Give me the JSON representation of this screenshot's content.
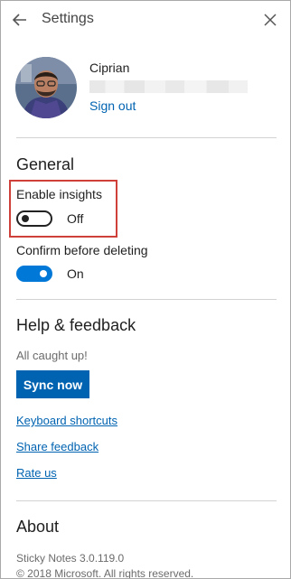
{
  "header": {
    "title": "Settings"
  },
  "account": {
    "name": "Ciprian",
    "sign_out": "Sign out"
  },
  "general": {
    "heading": "General",
    "enable_insights": {
      "label": "Enable insights",
      "state": "Off"
    },
    "confirm_delete": {
      "label": "Confirm before deleting",
      "state": "On"
    }
  },
  "help": {
    "heading": "Help & feedback",
    "status": "All caught up!",
    "sync_button": "Sync now",
    "links": {
      "keyboard_shortcuts": "Keyboard shortcuts",
      "share_feedback": "Share feedback",
      "rate_us": "Rate us"
    }
  },
  "about": {
    "heading": "About",
    "version": "Sticky Notes 3.0.119.0",
    "copyright": "© 2018 Microsoft. All rights reserved."
  },
  "colors": {
    "accent": "#0078d7",
    "link": "#0063b1",
    "highlight_border": "#d0403a"
  },
  "icons": {
    "back": "back-arrow-icon",
    "close": "close-icon"
  }
}
